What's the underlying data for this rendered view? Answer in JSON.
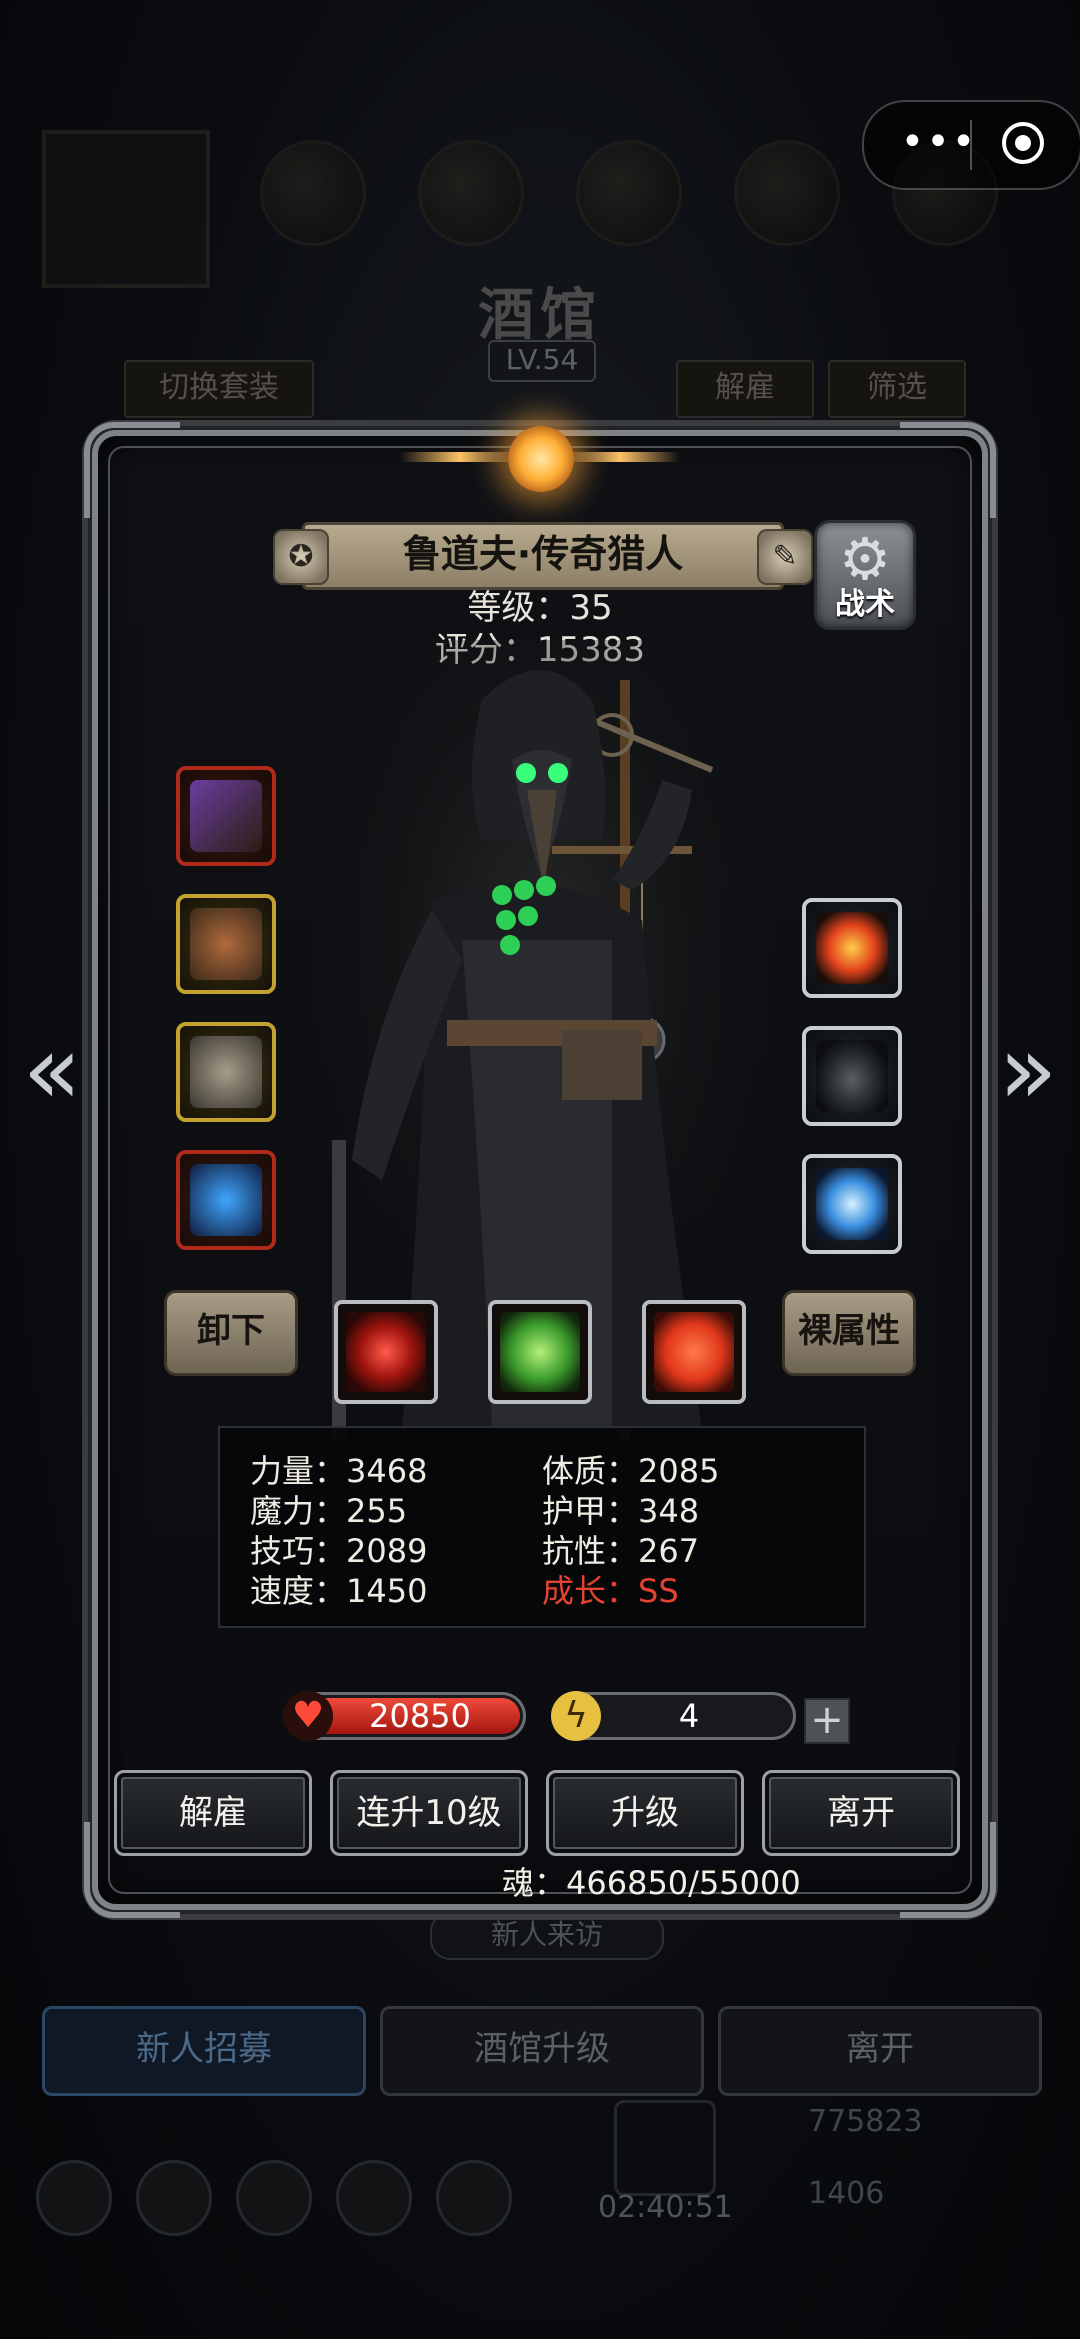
{
  "background": {
    "title": "酒馆",
    "level": "LV.54",
    "switch_set": "切换套装",
    "dismiss": "解雇",
    "filter": "筛选",
    "visitor": "新人来访",
    "bottom_tabs": [
      {
        "label": "新人招募"
      },
      {
        "label": "酒馆升级"
      },
      {
        "label": "离开"
      }
    ],
    "resources": {
      "gold": "775823",
      "gems": "1406"
    },
    "timer": "02:40:51"
  },
  "capsule": {
    "more": "•••",
    "close_icon": "target-icon"
  },
  "hero": {
    "name": "鲁道夫·传奇猎人",
    "level_text": "等级：35",
    "score_text": "评分：15383",
    "tactics_label": "战术",
    "unequip_label": "卸下",
    "naked_stats_label": "裸属性"
  },
  "equipment_left": [
    {
      "icon": "musket-icon",
      "rarity": "red"
    },
    {
      "icon": "chest-armor-icon",
      "rarity": "gold"
    },
    {
      "icon": "ring-icon",
      "rarity": "gold"
    },
    {
      "icon": "amulet-icon",
      "rarity": "red"
    }
  ],
  "equipment_right": [
    {
      "icon": "fire-rune-icon"
    },
    {
      "icon": "stone-icon"
    },
    {
      "icon": "crystal-egg-icon"
    }
  ],
  "skills": [
    {
      "icon": "target-skill-icon",
      "color": "#c3261b"
    },
    {
      "icon": "skull-skill-icon",
      "color": "#4fb634"
    },
    {
      "icon": "cross-skill-icon",
      "color": "#e2411d"
    }
  ],
  "stats": {
    "strength": "力量：3468",
    "magic": "魔力：255",
    "skill": "技巧：2089",
    "speed": "速度：1450",
    "constitution": "体质：2085",
    "armor": "护甲：348",
    "resistance": "抗性：267",
    "growth": "成长：SS"
  },
  "bars": {
    "hp": "20850",
    "hp_fill": 1.0,
    "energy": "4",
    "plus": "+"
  },
  "actions": {
    "dismiss": "解雇",
    "level_up_10": "连升10级",
    "level_up": "升级",
    "leave": "离开"
  },
  "soul": "魂：466850/55000",
  "nav": {
    "prev": "«",
    "next": "»"
  },
  "colors": {
    "accent_red": "#e64230",
    "hp_red": "#d02a1e",
    "plate": "#a39780"
  }
}
